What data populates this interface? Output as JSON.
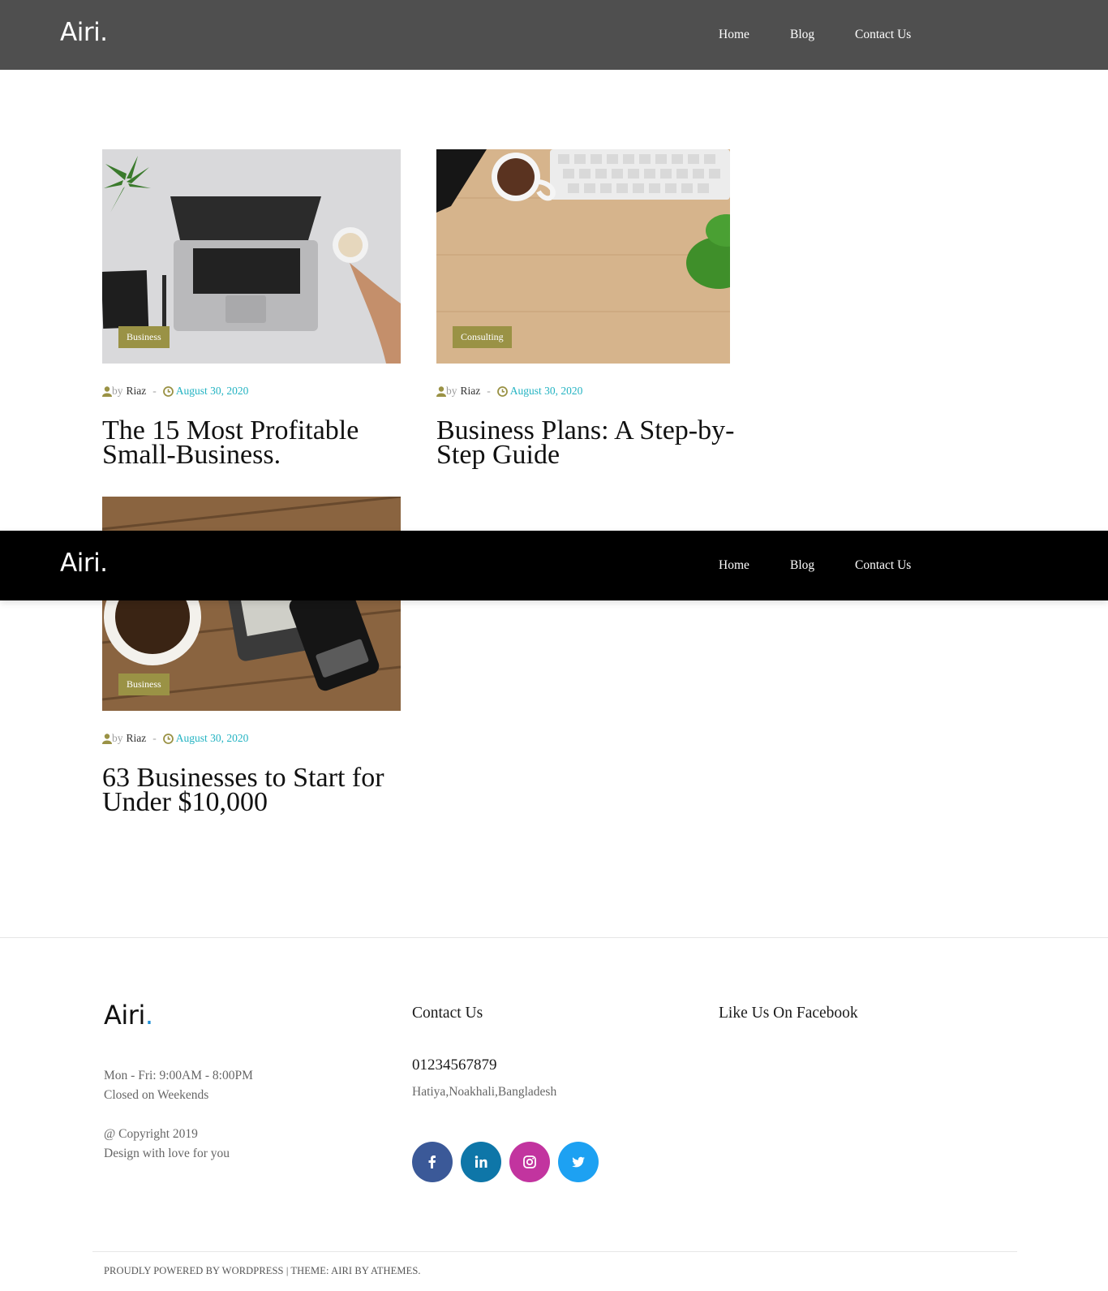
{
  "header": {
    "logo": "Airi.",
    "nav": [
      "Home",
      "Blog",
      "Contact Us"
    ]
  },
  "posts": [
    {
      "category": "Business",
      "meta_by": "by",
      "author": "Riaz",
      "separator": "-",
      "date": "August 30, 2020",
      "title": "The 15 Most Profitable Small-Business.",
      "image": "laptop-desk-photo"
    },
    {
      "category": "Consulting",
      "meta_by": "by",
      "author": "Riaz",
      "separator": "-",
      "date": "August 30, 2020",
      "title": "Business Plans: A Step-by-Step Guide",
      "image": "wooden-desk-keyboard-photo"
    },
    {
      "category": "Business",
      "meta_by": "by",
      "author": "Riaz",
      "separator": "-",
      "date": "August 30, 2020",
      "title": "63 Businesses to Start for Under $10,000",
      "image": "coffee-devices-photo"
    }
  ],
  "footer": {
    "logo_text": "Airi",
    "logo_dot": ".",
    "hours_line1": "Mon - Fri: 9:00AM - 8:00PM",
    "hours_line2": "Closed on Weekends",
    "copyright_line1": "@ Copyright 2019",
    "copyright_line2": "Design with love for you",
    "contact_heading": "Contact Us",
    "phone": "01234567879",
    "address": "Hatiya,Noakhali,Bangladesh",
    "facebook_heading": "Like Us On Facebook",
    "social": [
      {
        "icon": "facebook-icon",
        "color": "#3b5998"
      },
      {
        "icon": "linkedin-icon",
        "color": "#0e76a8"
      },
      {
        "icon": "instagram-icon",
        "color": "#c2349f"
      },
      {
        "icon": "twitter-icon",
        "color": "#1da1f2"
      }
    ],
    "credits": "Proudly powered by WordPress | Theme: Airi by aThemes."
  },
  "colors": {
    "header_bg": "#4f4f4f",
    "sticky_header_bg": "#000000",
    "badge_bg": "#9a9245",
    "date_color": "#23b3c2",
    "meta_icon_color": "#9a9245"
  }
}
